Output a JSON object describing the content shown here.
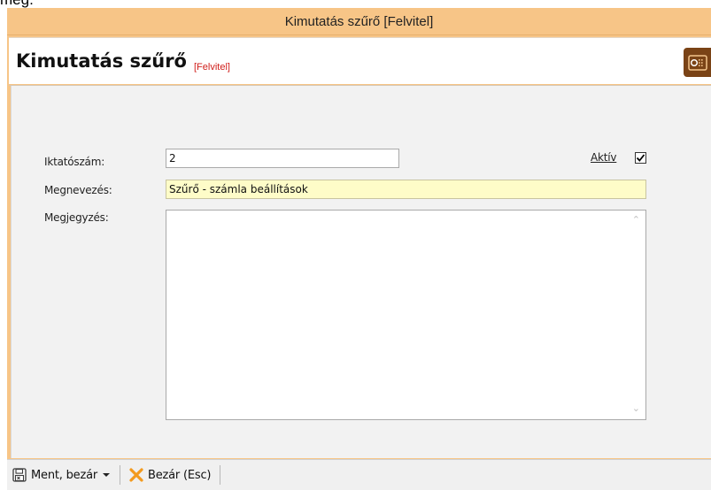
{
  "overflow_text": "meg.",
  "window": {
    "title": "Kimutatás szűrő [Felvitel]"
  },
  "header": {
    "title": "Kimutatás szűrő",
    "subtitle": "[Felvitel]",
    "icon": "safe-icon"
  },
  "form": {
    "iktatoszam_label": "Iktatószám:",
    "iktatoszam_value": "2",
    "aktiv_label": "Aktív",
    "aktiv_checked": true,
    "megnevezes_label": "Megnevezés:",
    "megnevezes_value": "Szűrő - számla beállítások",
    "megjegyzes_label": "Megjegyzés:",
    "megjegyzes_value": ""
  },
  "toolbar": {
    "save_close_label": "Ment, bezár",
    "close_label": "Bezár (Esc)"
  },
  "colors": {
    "titlebar": "#f7c587",
    "highlight_input": "#fefcc8",
    "close_icon": "#f39a1e",
    "header_subtitle": "#d0201c"
  }
}
